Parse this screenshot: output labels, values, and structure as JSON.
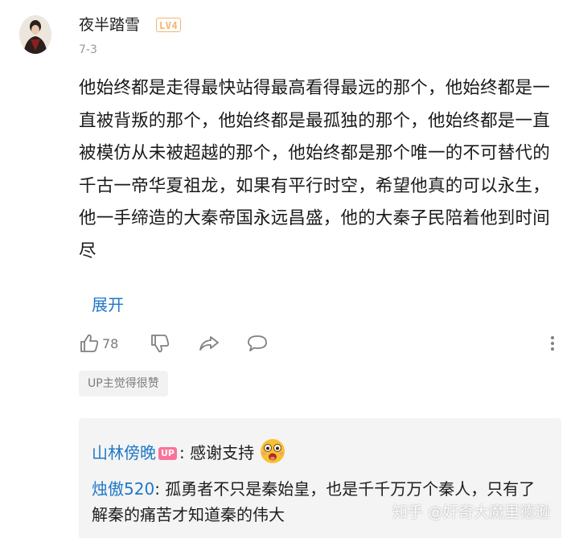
{
  "comment": {
    "username": "夜半踏雪",
    "level": "LV4",
    "date": "7-3",
    "text": "他始终都是走得最快站得最高看得最远的那个，他始终都是一直被背叛的那个，他始终都是最孤独的那个，他始终都是一直被模仿从未被超越的那个，他始终都是那个唯一的不可替代的千古一帝华夏祖龙，如果有平行时空，希望他真的可以永生，他一手缔造的大秦帝国永远昌盛，他的大秦子民陪着他到时间尽",
    "expand_label": "展开",
    "like_count": "78",
    "up_liked_label": "UP主觉得很赞"
  },
  "replies": [
    {
      "name": "山林傍晚",
      "up_tag": "UP",
      "text": ": 感谢支持"
    },
    {
      "name": "烛傲520",
      "text": ": 孤勇者不只是秦始皇，也是千千万万个秦人，只有了解秦的痛苦才知道秦的伟大"
    }
  ],
  "watermark": "知乎 @奸奇大魔里德逊",
  "icons": {
    "like": "thumbs-up-icon",
    "dislike": "thumbs-down-icon",
    "share": "share-icon",
    "reply": "comment-bubble-icon",
    "more": "more-vertical-icon",
    "emoji": "laughing-emoji-icon"
  },
  "colors": {
    "link_blue": "#1f78c8",
    "level_badge": "#f4b46f",
    "up_tag": "#fb7299"
  }
}
